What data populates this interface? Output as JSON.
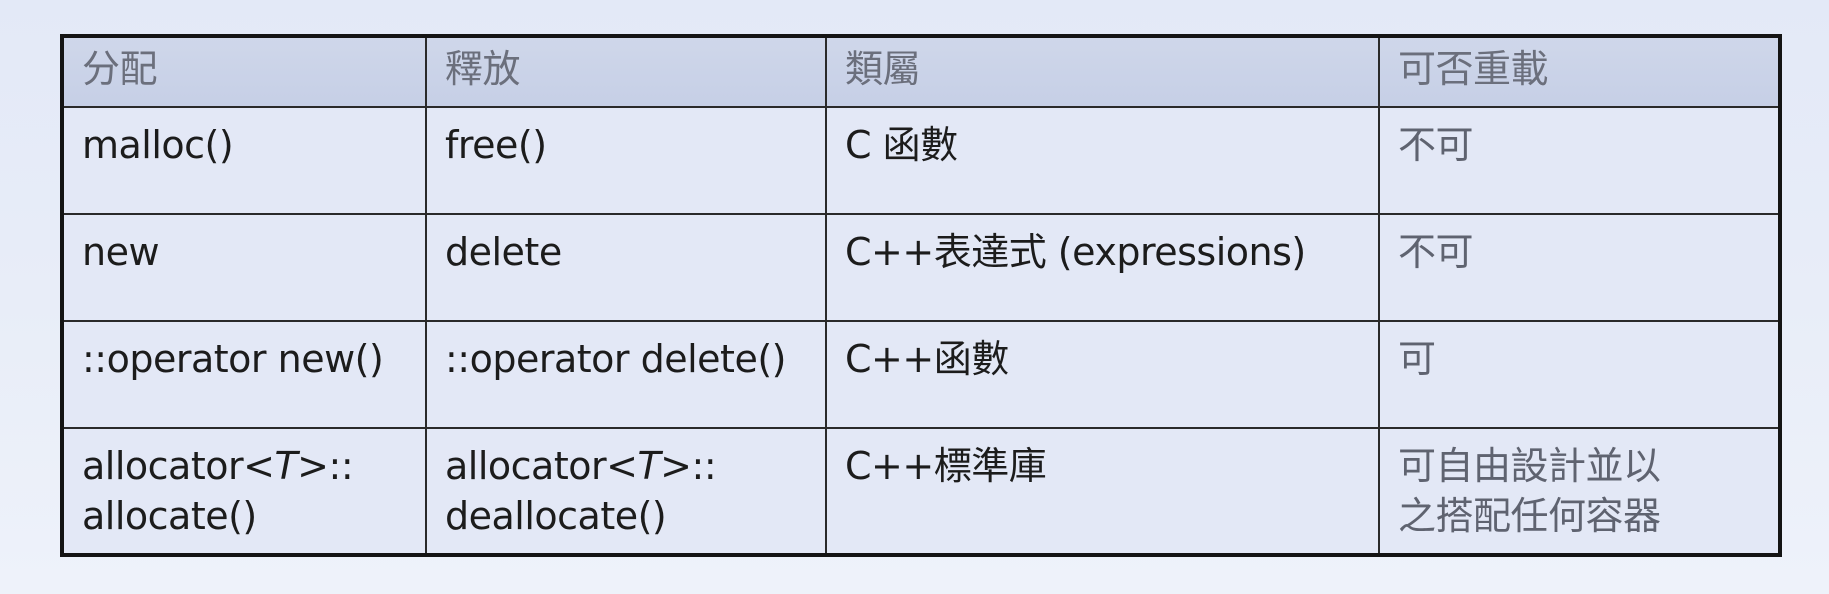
{
  "table": {
    "headers": [
      "分配",
      "釋放",
      "類屬",
      "可否重載"
    ],
    "rows": [
      {
        "alloc": [
          "malloc()"
        ],
        "free": [
          "free()"
        ],
        "kind": "C 函數",
        "overload": [
          "不可"
        ]
      },
      {
        "alloc": [
          "new"
        ],
        "free": [
          "delete"
        ],
        "kind": "C++表達式 (expressions)",
        "overload": [
          "不可"
        ]
      },
      {
        "alloc": [
          "::operator new()"
        ],
        "free": [
          "::operator delete()"
        ],
        "kind": "C++函數",
        "overload": [
          "可"
        ]
      },
      {
        "alloc_prefix": "allocator<",
        "alloc_t": "T",
        "alloc_suffix": ">::",
        "alloc_line2": "allocate()",
        "free_prefix": "allocator<",
        "free_t": "T",
        "free_suffix": ">::",
        "free_line2": "deallocate()",
        "kind": "C++標準庫",
        "overload": [
          "可自由設計並以",
          "之搭配任何容器"
        ]
      }
    ]
  }
}
